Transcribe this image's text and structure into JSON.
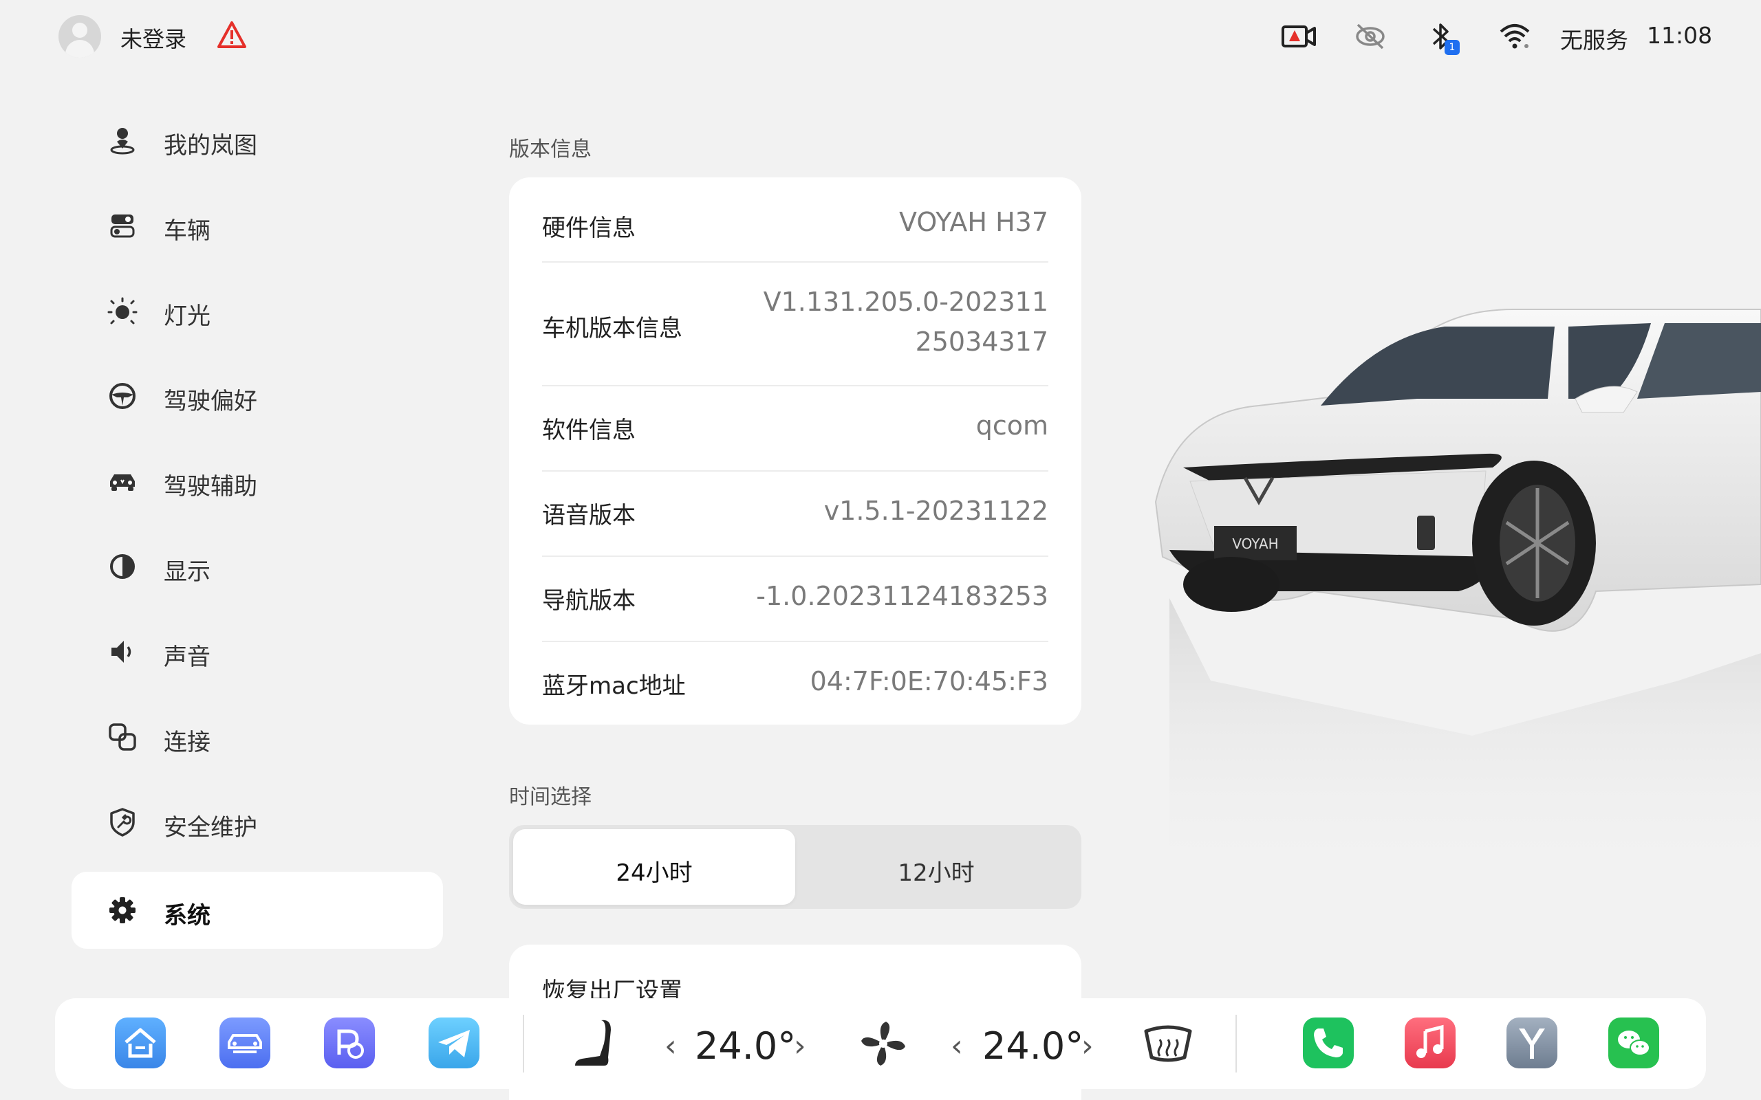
{
  "status_bar": {
    "login_status": "未登录",
    "service_text": "无服务",
    "time": "11:08",
    "bluetooth_badge": "1",
    "icons": [
      "user-avatar-icon",
      "warning-icon",
      "dashcam-warning-icon",
      "camera-off-icon",
      "bluetooth-icon",
      "wifi-icon"
    ]
  },
  "sidebar": {
    "items": [
      {
        "label": "我的岚图",
        "icon": "person-location-icon"
      },
      {
        "label": "车辆",
        "icon": "vehicle-switch-icon"
      },
      {
        "label": "灯光",
        "icon": "light-icon"
      },
      {
        "label": "驾驶偏好",
        "icon": "steering-wheel-icon"
      },
      {
        "label": "驾驶辅助",
        "icon": "car-assist-icon"
      },
      {
        "label": "显示",
        "icon": "display-contrast-icon"
      },
      {
        "label": "声音",
        "icon": "speaker-icon"
      },
      {
        "label": "连接",
        "icon": "connection-icon"
      },
      {
        "label": "安全维护",
        "icon": "shield-wrench-icon"
      },
      {
        "label": "系统",
        "icon": "gear-icon"
      }
    ],
    "active_index": 9
  },
  "version_info": {
    "title": "版本信息",
    "rows": [
      {
        "key": "硬件信息",
        "value": "VOYAH H37"
      },
      {
        "key": "车机版本信息",
        "value_line1": "V1.131.205.0-202311",
        "value_line2": "25034317"
      },
      {
        "key": "软件信息",
        "value": "qcom"
      },
      {
        "key": "语音版本",
        "value": "v1.5.1-20231122"
      },
      {
        "key": "导航版本",
        "value": "-1.0.20231124183253"
      },
      {
        "key": "蓝牙mac地址",
        "value": "04:7F:0E:70:45:F3"
      }
    ]
  },
  "time_select": {
    "title": "时间选择",
    "options": [
      "24小时",
      "12小时"
    ],
    "selected": "24小时"
  },
  "reset": {
    "label": "恢复出厂设置"
  },
  "car_image": {
    "badge_text": "VOYAH"
  },
  "dock": {
    "apps_left": [
      "home-app-icon",
      "car-app-icon",
      "parking-app-icon",
      "telegram-app-icon"
    ],
    "seat_icon": "seat-heat-icon",
    "left_temp": "24.0°",
    "fan_icon": "fan-icon",
    "right_temp": "24.0°",
    "defrost_icon": "rear-defrost-icon",
    "apps_right": [
      "phone-app-icon",
      "music-app-icon",
      "voyah-app-icon",
      "wechat-app-icon"
    ],
    "colors": {
      "home": "#4a9cf0",
      "car": "#5b82f5",
      "parking": "#6470f0",
      "telegram": "#42aef0",
      "phone": "#1ec25e",
      "music": "#f24a5c",
      "voyah": "#7f8ea0",
      "wechat": "#27c150"
    }
  }
}
